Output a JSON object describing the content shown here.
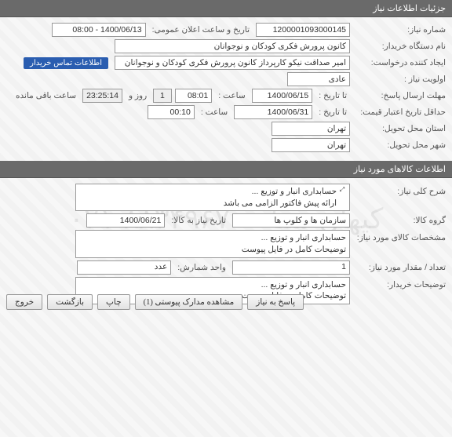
{
  "watermark": "کیهان سنا - ۸۸۳۴۹۶۷۰-۰۲۱",
  "panels": {
    "need_info_header": "جزئیات اطلاعات نیاز",
    "items_info_header": "اطلاعات کالاهای مورد نیاز"
  },
  "labels": {
    "need_number": "شماره نیاز:",
    "announce_datetime": "تاریخ و ساعت اعلان عمومی:",
    "buyer_dept": "نام دستگاه خریدار:",
    "request_creator": "ایجاد کننده درخواست:",
    "priority": "اولویت نیاز :",
    "response_deadline": "مهلت ارسال پاسخ:",
    "to_date": "تا تاریخ :",
    "time": "ساعت :",
    "days_and": "روز و",
    "hours_remaining": "ساعت باقی مانده",
    "price_min_date": "حداقل تاریخ اعتبار قیمت:",
    "delivery_province": "استان محل تحویل:",
    "delivery_city": "شهر محل تحویل:",
    "need_desc": "شرح کلی نیاز:",
    "product_group": "گروه کالا:",
    "need_to_product_date": "تاریخ نیاز به کالا:",
    "item_spec": "مشخصات کالای مورد نیاز:",
    "qty": "تعداد / مقدار مورد نیاز:",
    "unit": "واحد شمارش:",
    "buyer_comments": "توضیحات خریدار:",
    "contact_tag": "اطلاعات تماس خریدار"
  },
  "values": {
    "need_number": "1200001093000145",
    "announce_datetime": "1400/06/13 - 08:00",
    "buyer_dept": "کانون پرورش فکری کودکان و نوجوانان",
    "request_creator": "امیر صداقت نیکو کارپرداز کانون پرورش فکری کودکان و نوجوانان",
    "priority": "عادی",
    "deadline_date": "1400/06/15",
    "deadline_time": "08:01",
    "deadline_days": "1",
    "deadline_countdown": "23:25:14",
    "price_date": "1400/06/31",
    "price_time": "00:10",
    "province": "تهران",
    "city": "تهران",
    "need_desc_line1": "حسابداری انبار و توزیع ...",
    "need_desc_line2": "ارائه پیش فاکتور الزامی می باشد",
    "product_group": "سازمان ها و کلوپ ها",
    "need_to_product_date": "1400/06/21",
    "item_spec_line1": "حسابداری انبار و توزیع ...",
    "item_spec_line2": "توضیحات کامل در  فایل پیوست",
    "qty": "1",
    "unit": "عدد",
    "buyer_comments_line1": "حسابداری انبار و توزیع ...",
    "buyer_comments_line2": "توضیحات کامل در  فایل پیوست"
  },
  "buttons": {
    "exit": "خروج",
    "back": "بازگشت",
    "print": "چاپ",
    "attachments": "مشاهده مدارک پیوستی (1)",
    "respond": "پاسخ به نیاز"
  }
}
